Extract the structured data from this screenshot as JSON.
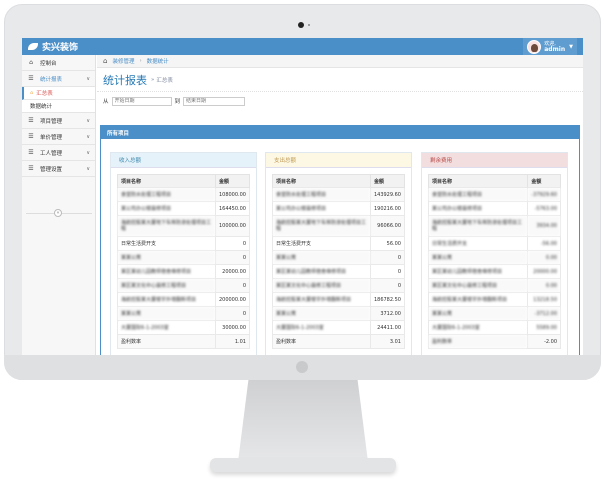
{
  "app": {
    "brand": "实兴装饰",
    "user": {
      "greeting": "欢迎,",
      "name": "admin"
    }
  },
  "sidebar": {
    "items": [
      {
        "label": "控制台",
        "icon": "dashboard-icon"
      },
      {
        "label": "统计报表",
        "icon": "list-icon",
        "active": true
      },
      {
        "label": "项目管理",
        "icon": "list-icon"
      },
      {
        "label": "单价管理",
        "icon": "list-icon"
      },
      {
        "label": "工人管理",
        "icon": "list-icon"
      },
      {
        "label": "管理设置",
        "icon": "list-icon"
      }
    ],
    "subitems": [
      "汇总表",
      "数据统计"
    ]
  },
  "breadcrumb": {
    "home": "装修管理",
    "current": "数据统计"
  },
  "page": {
    "title": "统计报表",
    "subtitle": "汇总表"
  },
  "filters": {
    "from_label": "从",
    "from_placeholder": "开始日期",
    "to_label": "到",
    "to_placeholder": "结束日期"
  },
  "panel": {
    "title": "所有项目"
  },
  "columns": [
    {
      "title": "收入总额",
      "head_bg": "#e6f2f9",
      "head_color": "#3a87ad",
      "header": [
        "项目名称",
        "金额"
      ],
      "rows": [
        {
          "name": "食堂防水处理工程项目",
          "amount": "108000.00"
        },
        {
          "name": "某公司办公楼装修项目",
          "amount": "164450.00"
        },
        {
          "name": "海航控股某大厦地下车库防渗处理项目工程",
          "amount": "100000.00"
        },
        {
          "name": "日常生活费开支",
          "amount": "0"
        },
        {
          "name": "某某公寓",
          "amount": "0"
        },
        {
          "name": "某区某幼儿园教师宿舍维修项目",
          "amount": "20000.00"
        },
        {
          "name": "某区某文化中心装修工程项目",
          "amount": "0"
        },
        {
          "name": "海航控股某大厦楼宇外墙翻新项目",
          "amount": "200000.00"
        },
        {
          "name": "某某公寓",
          "amount": "0"
        },
        {
          "name": "大厦国际6-1-2003室",
          "amount": "30000.00"
        },
        {
          "name": "盈利数率",
          "amount": "1.01"
        }
      ]
    },
    {
      "title": "支出总额",
      "head_bg": "#fcf8e3",
      "head_color": "#c09853",
      "header": [
        "项目名称",
        "金额"
      ],
      "rows": [
        {
          "name": "食堂防水处理工程项目",
          "amount": "143929.60"
        },
        {
          "name": "某公司办公楼装修项目",
          "amount": "190216.00"
        },
        {
          "name": "海航控股某大厦地下车库防渗处理项目工程",
          "amount": "96066.00"
        },
        {
          "name": "日常生活费开支",
          "amount": "56.00"
        },
        {
          "name": "某某公寓",
          "amount": "0"
        },
        {
          "name": "某区某幼儿园教师宿舍维修项目",
          "amount": "0"
        },
        {
          "name": "某区某文化中心装修工程项目",
          "amount": "0"
        },
        {
          "name": "海航控股某大厦楼宇外墙翻新项目",
          "amount": "186782.50"
        },
        {
          "name": "某某公寓",
          "amount": "3712.00"
        },
        {
          "name": "大厦国际6-1-2003室",
          "amount": "24411.00"
        },
        {
          "name": "盈利数率",
          "amount": "3.01"
        }
      ]
    },
    {
      "title": "剩余费用",
      "head_bg": "#f2dede",
      "head_color": "#b94a48",
      "header": [
        "项目名称",
        "金额"
      ],
      "rows": [
        {
          "name": "食堂防水处理工程项目",
          "amount": "-37929.60"
        },
        {
          "name": "某公司办公楼装修项目",
          "amount": "-5763.00"
        },
        {
          "name": "海航控股某大厦地下车库防渗处理项目工程",
          "amount": "3934.00"
        },
        {
          "name": "日常生活费开支",
          "amount": "-56.00"
        },
        {
          "name": "某某公寓",
          "amount": "0.00"
        },
        {
          "name": "某区某幼儿园教师宿舍维修项目",
          "amount": "20000.00"
        },
        {
          "name": "某区某文化中心装修工程项目",
          "amount": "0.00"
        },
        {
          "name": "海航控股某大厦楼宇外墙翻新项目",
          "amount": "13218.50"
        },
        {
          "name": "某某公寓",
          "amount": "-3712.00"
        },
        {
          "name": "大厦国际6-1-2003室",
          "amount": "5589.00"
        },
        {
          "name": "盈利数率",
          "amount": "-2.00"
        }
      ]
    }
  ]
}
